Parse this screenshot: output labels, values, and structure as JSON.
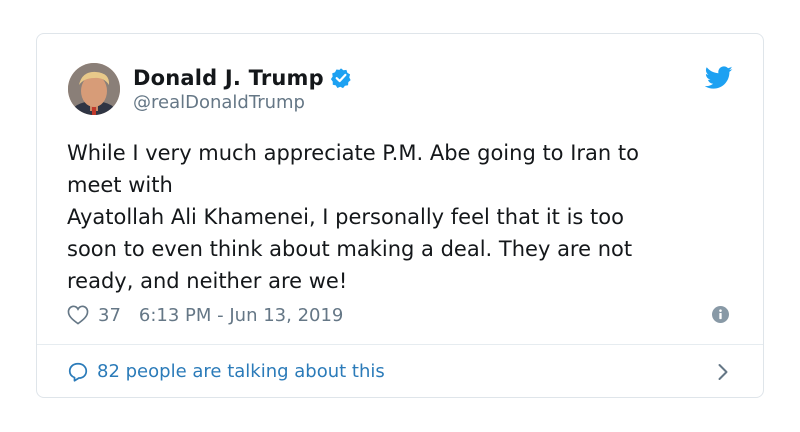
{
  "user": {
    "display_name": "Donald J. Trump",
    "handle": "@realDonaldTrump",
    "verified": true,
    "avatar_icon": "profile-photo"
  },
  "tweet": {
    "lines": [
      "While I very much appreciate P.M. Abe going to Iran to",
      "meet with",
      "Ayatollah Ali Khamenei, I personally feel that it is too",
      "soon to even think about making a deal. They are not",
      "ready, and neither are we!"
    ]
  },
  "meta": {
    "likes": "37",
    "timestamp": "6:13 PM - Jun 13, 2019"
  },
  "footer": {
    "talking_text": "82 people are talking about this"
  },
  "icons": {
    "brand": "twitter-bird-icon",
    "verified": "verified-badge-icon",
    "like": "heart-icon",
    "info": "info-icon",
    "conversation": "chat-bubble-icon",
    "more": "chevron-right-icon"
  },
  "colors": {
    "brand_blue": "#1da1f2",
    "link_blue": "#2b7bb9",
    "text_primary": "#14171a",
    "text_secondary": "#657786",
    "border": "#dfe5ea"
  }
}
